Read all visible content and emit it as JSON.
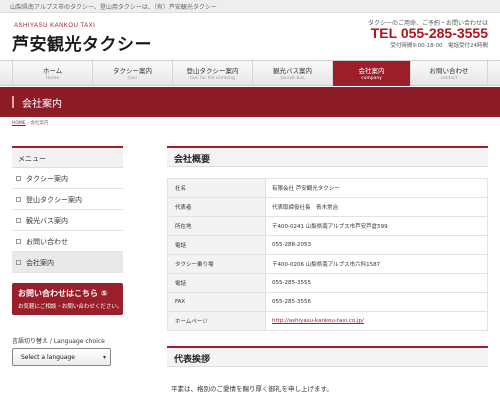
{
  "topbar": {
    "text": "山梨県南アルプス市のタクシー、登山用タクシーは、（有）芦安観光タクシー"
  },
  "header": {
    "logo_sub": "ASHIYASU KANKOU TAXI",
    "logo": "芦安観光タクシー",
    "contact_lead": "タクシーのご用命、ご予約・お問い合わせは",
    "tel": "TEL 055-285-3555",
    "hours": "受付時間9:00-18:00　電話受付24時間"
  },
  "nav": [
    {
      "jp": "ホーム",
      "en": "Home",
      "active": false
    },
    {
      "jp": "タクシー案内",
      "en": "taxi",
      "active": false
    },
    {
      "jp": "登山タクシー案内",
      "en": "taxi for hill climbing",
      "active": false
    },
    {
      "jp": "観光バス案内",
      "en": "tourist bus",
      "active": false
    },
    {
      "jp": "会社案内",
      "en": "company",
      "active": true
    },
    {
      "jp": "お問い合わせ",
      "en": "contact",
      "active": false
    }
  ],
  "banner": {
    "title": "会社案内"
  },
  "breadcrumb": {
    "home": "HOME",
    "separator": "›",
    "current": "会社案内"
  },
  "sidebar": {
    "title": "メニュー",
    "items": [
      {
        "label": "タクシー案内"
      },
      {
        "label": "登山タクシー案内"
      },
      {
        "label": "観光バス案内"
      },
      {
        "label": "お問い合わせ"
      },
      {
        "label": "会社案内"
      }
    ],
    "inquiry_line1": "お問い合わせはこちら ⑤",
    "inquiry_line2": "お気軽にご相談・お問い合わせください。",
    "lang_label": "言語切り替え / Language choice",
    "lang_selected": "Select a language",
    "lang_arrow": "▾"
  },
  "company": {
    "heading": "会社概要",
    "rows": [
      {
        "key": "社名",
        "value": "有限会社 芦安観光タクシー"
      },
      {
        "key": "代表者",
        "value": "代表取締役社長　青木常治"
      },
      {
        "key": "所在地",
        "value": "〒400-0241 山梨県南アルプス市芦安芦倉599"
      },
      {
        "key": "電話",
        "value": "055-288-2053"
      },
      {
        "key": "タクシー乗り場",
        "value": "〒400-0206 山梨県南アルプス市六科1587"
      },
      {
        "key": "電話",
        "value": "055-285-3555"
      },
      {
        "key": "FAX",
        "value": "055-285-3556"
      },
      {
        "key": "ホームページ",
        "value": "http://ashiyasu-kankou-taxi.co.jp/"
      }
    ]
  },
  "greeting": {
    "heading": "代表挨拶",
    "text": "平素は、格別のご愛情を賜り厚く御礼を申し上げます。"
  },
  "colors": {
    "brand": "#9b1f2a",
    "tel": "#b3121e"
  }
}
